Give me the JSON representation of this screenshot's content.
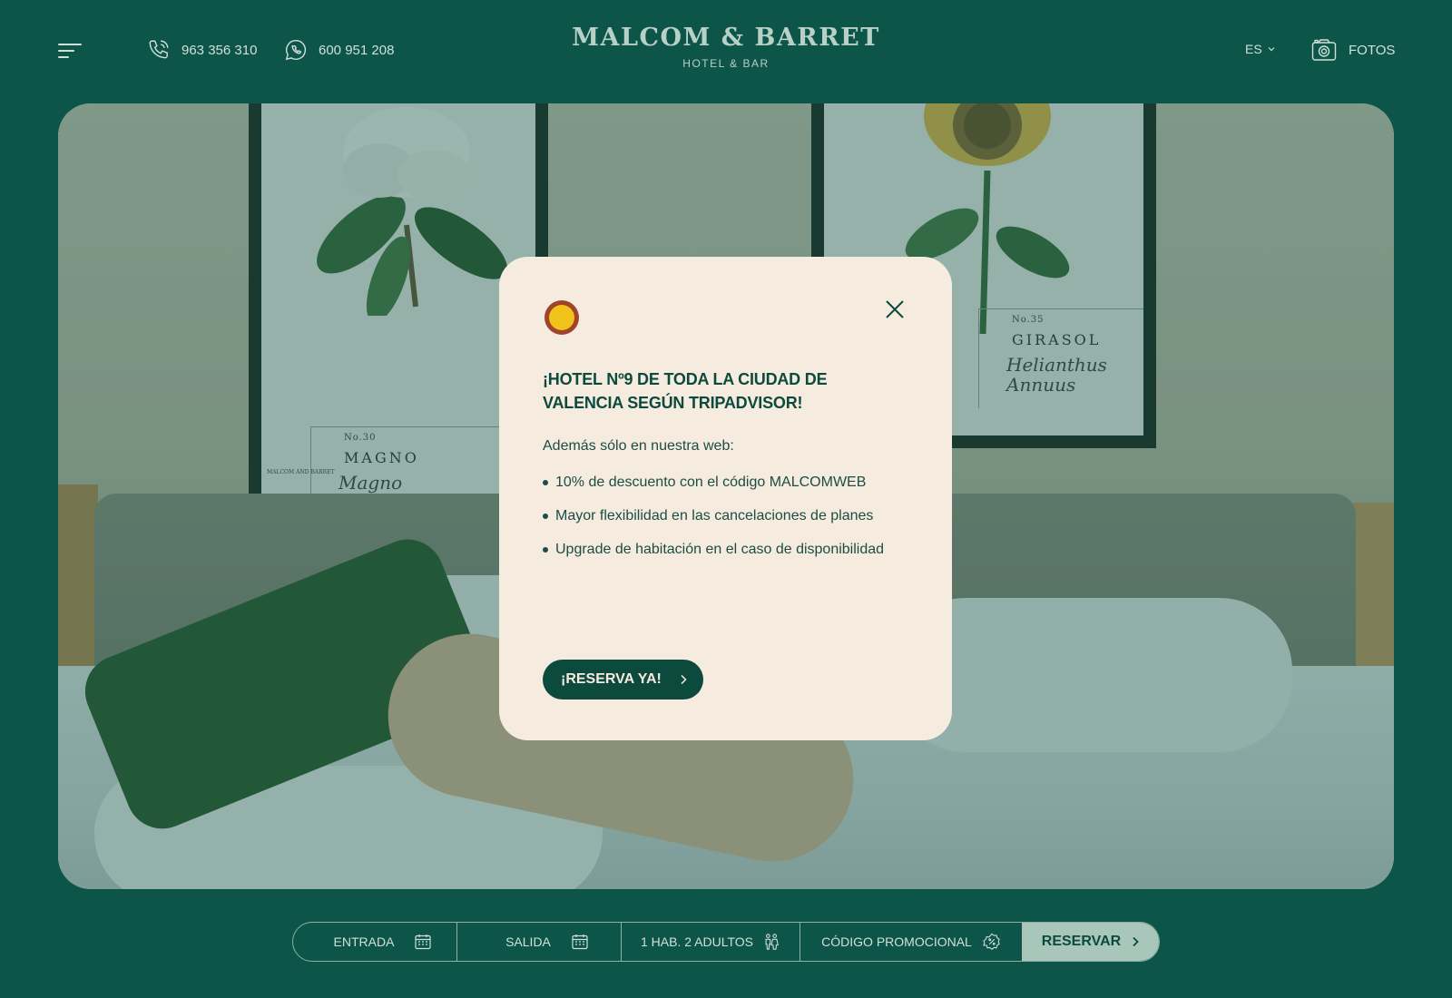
{
  "header": {
    "phone": "963 356 310",
    "whatsapp": "600 951 208",
    "brand_name": "MALCOM & BARRET",
    "brand_sub": "HOTEL & BAR",
    "language": "ES",
    "photos_label": "FOTOS"
  },
  "hero": {
    "frame_left": {
      "no": "No.30",
      "name": "MAGNO",
      "latin": "Magno\nGrand",
      "label": "MALCOM AND BARRET"
    },
    "frame_right": {
      "no": "No.35",
      "name": "GIRASOL",
      "latin": "Helianthus\nAnnuus"
    }
  },
  "modal": {
    "title": "¡HOTEL Nº9 DE TODA LA CIUDAD DE VALENCIA SEGÚN TRIPADVISOR!",
    "intro": "Además sólo en nuestra web:",
    "benefits": [
      "10% de descuento con el código MALCOMWEB",
      "Mayor flexibilidad en las cancelaciones de planes",
      "Upgrade de habitación en el caso de disponibilidad"
    ],
    "cta_label": "¡RESERVA YA!"
  },
  "booking": {
    "checkin": "ENTRADA",
    "checkout": "SALIDA",
    "guests": "1 HAB. 2 ADULTOS",
    "promo": "CÓDIGO PROMOCIONAL",
    "submit": "RESERVAR"
  },
  "colors": {
    "background": "#0d5548",
    "modal_bg": "#f6ebdf",
    "primary": "#0d4a3e",
    "badge": "#f2c31b",
    "badge_ring": "#a0452a"
  }
}
